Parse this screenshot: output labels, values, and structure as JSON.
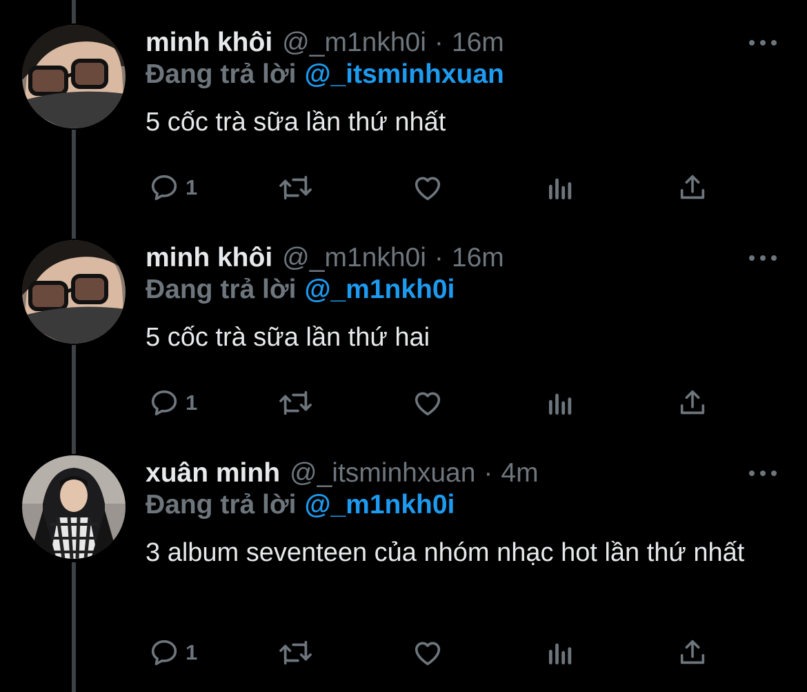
{
  "colors": {
    "background": "#000000",
    "primary_text": "#e7e9ea",
    "secondary_text": "#6e767d",
    "accent": "#1d9bf0",
    "thread_line": "#3d4247"
  },
  "tweets": [
    {
      "name": "minh khôi",
      "handle": "@_m1nkh0i",
      "dot": "·",
      "time": "16m",
      "reply_prefix": "Đang trả lời",
      "reply_to": "@_itsminhxuan",
      "text": "5 cốc trà sữa lần thứ nhất",
      "reply_count": "1",
      "avatar_icon": "avatar-minh-khoi"
    },
    {
      "name": "minh khôi",
      "handle": "@_m1nkh0i",
      "dot": "·",
      "time": "16m",
      "reply_prefix": "Đang trả lời",
      "reply_to": "@_m1nkh0i",
      "text": "5 cốc trà sữa lần thứ hai",
      "reply_count": "1",
      "avatar_icon": "avatar-minh-khoi"
    },
    {
      "name": "xuân minh",
      "handle": "@_itsminhxuan",
      "dot": "·",
      "time": "4m",
      "reply_prefix": "Đang trả lời",
      "reply_to": "@_m1nkh0i",
      "text": "3 album seventeen của nhóm nhạc hot lần thứ nhất",
      "reply_count": "1",
      "avatar_icon": "avatar-xuan-minh"
    }
  ],
  "icons": {
    "reply": "reply-icon",
    "retweet": "retweet-icon",
    "like": "like-icon",
    "analytics": "analytics-icon",
    "share": "share-icon",
    "more": "more-icon"
  }
}
